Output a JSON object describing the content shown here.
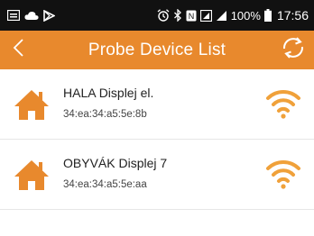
{
  "status_bar": {
    "battery": "100%",
    "time": "17:56"
  },
  "app_bar": {
    "title": "Probe Device List"
  },
  "colors": {
    "accent": "#e8892d",
    "status_bar_bg": "#111111"
  },
  "devices": [
    {
      "name": "HALA Displej el.",
      "mac": "34:ea:34:a5:5e:8b",
      "icon": "house-icon",
      "signal_icon": "wifi-icon"
    },
    {
      "name": "OBYVÁK Displej 7",
      "mac": "34:ea:34:a5:5e:aa",
      "icon": "house-icon",
      "signal_icon": "wifi-icon"
    }
  ]
}
